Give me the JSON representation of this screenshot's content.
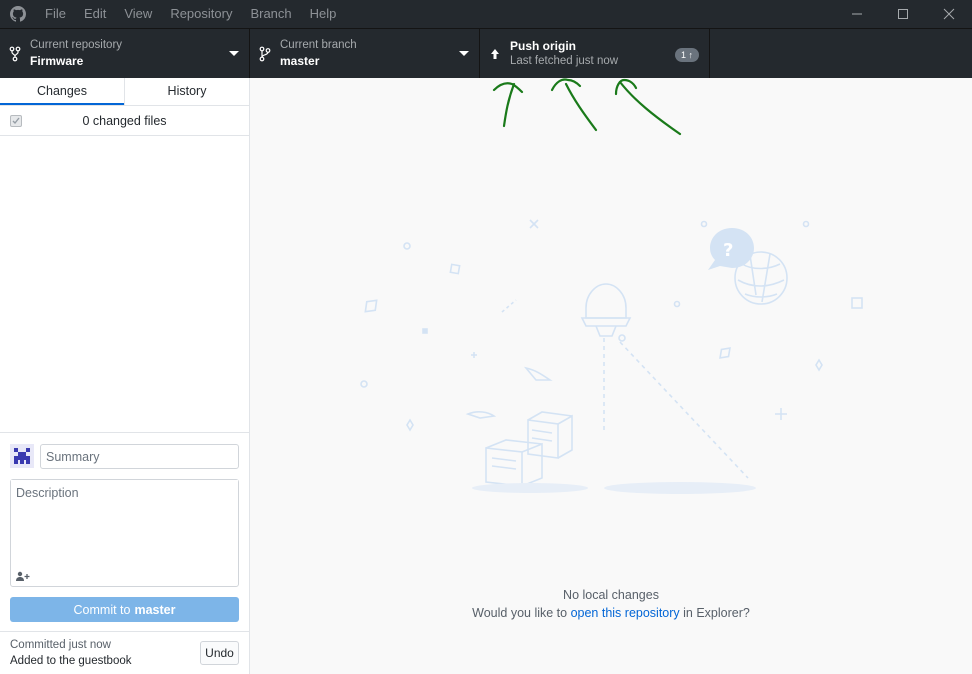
{
  "menu": [
    "File",
    "Edit",
    "View",
    "Repository",
    "Branch",
    "Help"
  ],
  "toolbar": {
    "repo_label": "Current repository",
    "repo_value": "Firmware",
    "branch_label": "Current branch",
    "branch_value": "master",
    "push_title": "Push origin",
    "push_subtitle": "Last fetched just now",
    "push_badge": "1 ↑"
  },
  "tabs": [
    "Changes",
    "History"
  ],
  "changes": {
    "count_label": "0 changed files"
  },
  "commit": {
    "summary_placeholder": "Summary",
    "description_placeholder": "Description",
    "button_prefix": "Commit to",
    "button_branch": "master"
  },
  "last_commit": {
    "time": "Committed just now",
    "message": "Added to the guestbook",
    "undo_label": "Undo"
  },
  "main": {
    "no_changes": "No local changes",
    "prompt_before": "Would you like to ",
    "prompt_link": "open this repository",
    "prompt_after": " in Explorer?"
  },
  "colors": {
    "titlebar": "#24292e",
    "accent": "#0366d6",
    "commit_button": "#7db5e8",
    "annotation": "#1a7a1a"
  }
}
